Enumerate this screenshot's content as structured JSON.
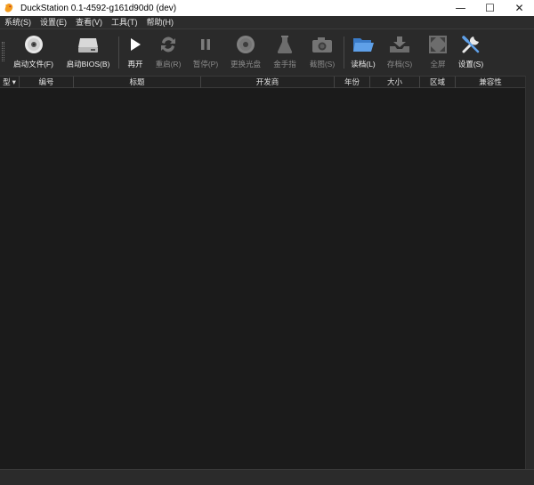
{
  "window": {
    "title": "DuckStation 0.1-4592-g161d90d0 (dev)",
    "controls": {
      "minimize": "—",
      "maximize": "☐",
      "close": "✕"
    }
  },
  "menu": [
    "系统(S)",
    "设置(E)",
    "查看(V)",
    "工具(T)",
    "帮助(H)"
  ],
  "toolbar": {
    "start_file": "启动文件(F)",
    "start_bios": "启动BIOS(B)",
    "resume": "再开",
    "reset": "重启(R)",
    "pause": "暂停(P)",
    "change_disc": "更换光盘",
    "cheats": "金手指",
    "screenshot": "截图(S)",
    "load_state": "读档(L)",
    "save_state": "存档(S)",
    "fullscreen": "全屏",
    "settings": "设置(S)"
  },
  "table": {
    "columns": [
      "型",
      "编号",
      "标题",
      "开发商",
      "年份",
      "大小",
      "区域",
      "兼容性"
    ],
    "sort_indicator": "▾"
  }
}
